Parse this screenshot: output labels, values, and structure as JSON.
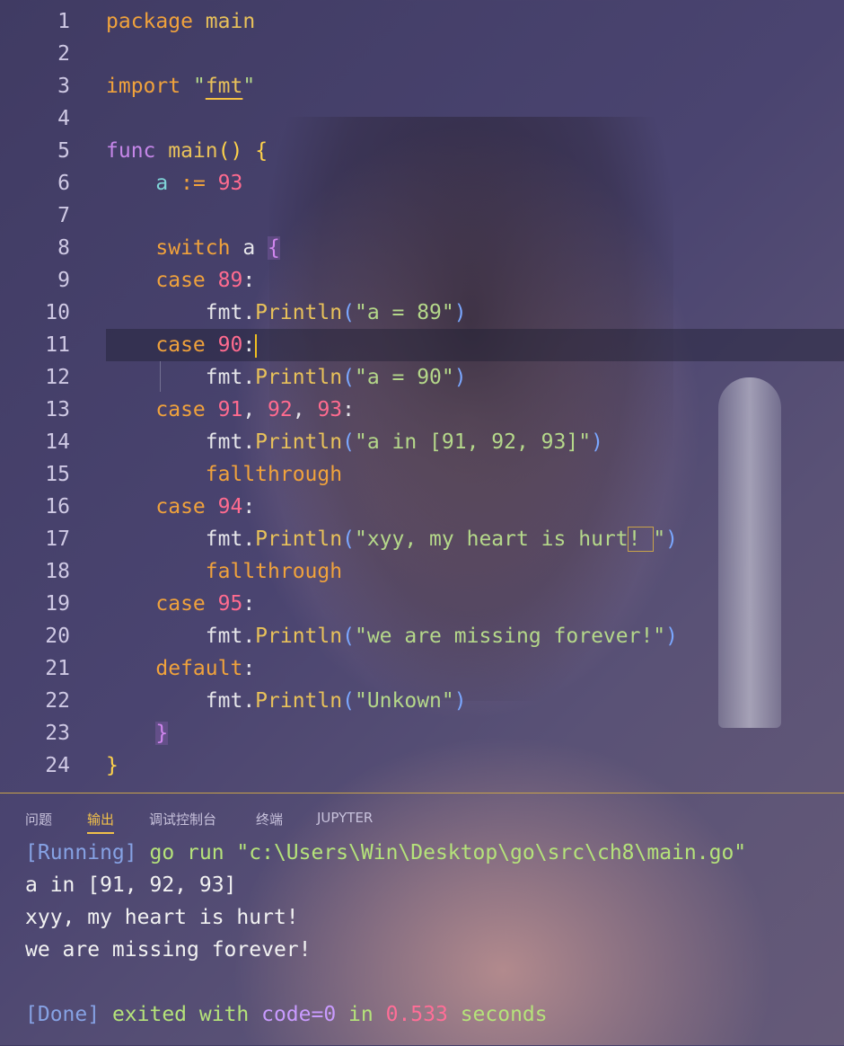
{
  "editor": {
    "lines": [
      {
        "n": "1",
        "t": "package main"
      },
      {
        "n": "2",
        "t": ""
      },
      {
        "n": "3",
        "t": "import \"fmt\""
      },
      {
        "n": "4",
        "t": ""
      },
      {
        "n": "5",
        "t": "func main() {"
      },
      {
        "n": "6",
        "t": "    a := 93"
      },
      {
        "n": "7",
        "t": ""
      },
      {
        "n": "8",
        "t": "    switch a {"
      },
      {
        "n": "9",
        "t": "    case 89:"
      },
      {
        "n": "10",
        "t": "        fmt.Println(\"a = 89\")"
      },
      {
        "n": "11",
        "t": "    case 90:"
      },
      {
        "n": "12",
        "t": "        fmt.Println(\"a = 90\")"
      },
      {
        "n": "13",
        "t": "    case 91, 92, 93:"
      },
      {
        "n": "14",
        "t": "        fmt.Println(\"a in [91, 92, 93]\")"
      },
      {
        "n": "15",
        "t": "        fallthrough"
      },
      {
        "n": "16",
        "t": "    case 94:"
      },
      {
        "n": "17",
        "t": "        fmt.Println(\"xyy, my heart is hurt! \")"
      },
      {
        "n": "18",
        "t": "        fallthrough"
      },
      {
        "n": "19",
        "t": "    case 95:"
      },
      {
        "n": "20",
        "t": "        fmt.Println(\"we are missing forever!\")"
      },
      {
        "n": "21",
        "t": "    default:"
      },
      {
        "n": "22",
        "t": "        fmt.Println(\"Unkown\")"
      },
      {
        "n": "23",
        "t": "    }"
      },
      {
        "n": "24",
        "t": "}"
      }
    ],
    "current_line": "11"
  },
  "panel": {
    "tabs": [
      "问题",
      "输出",
      "调试控制台",
      "终端",
      "JUPYTER"
    ],
    "active_tab": "输出",
    "output": {
      "running_tag": "[Running]",
      "running_cmd": " go run \"c:\\Users\\Win\\Desktop\\go\\src\\ch8\\main.go\"",
      "lines": [
        "a in [91, 92, 93]",
        "xyy, my heart is hurt!",
        "we are missing forever!"
      ],
      "done_tag": "[Done]",
      "done_text1": " exited with ",
      "done_code": "code=0",
      "done_text2": " in ",
      "done_time": "0.533",
      "done_text3": " seconds"
    }
  },
  "colors": {
    "keyword": "#f0a23c",
    "function_keyword": "#c586e8",
    "variable": "#7fd4d8",
    "number": "#ff6b8f",
    "string": "#b5d88a",
    "method": "#e8c15a",
    "active_tab": "#f1c04a",
    "panel_border": "#c9a34a"
  }
}
